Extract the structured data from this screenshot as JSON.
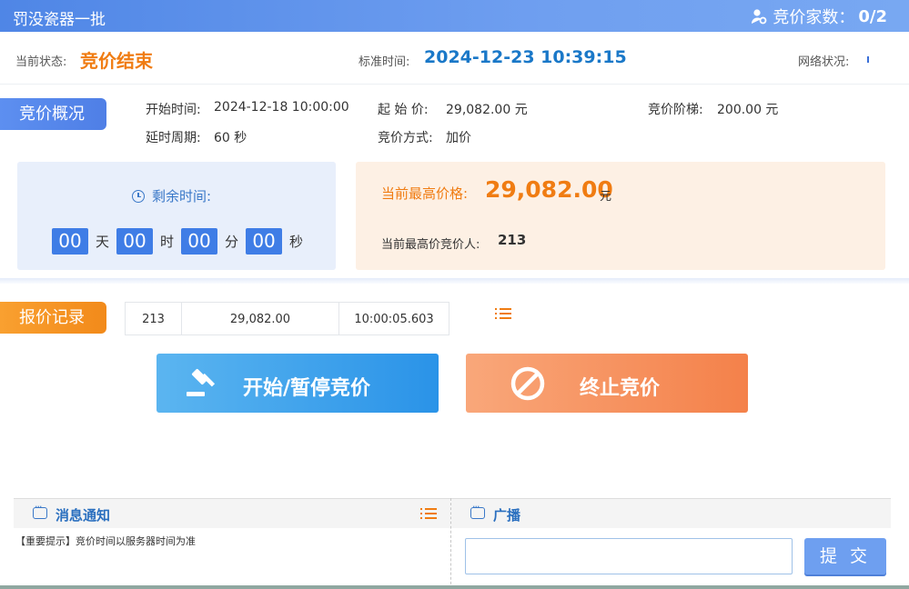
{
  "titlebar": {
    "title": "罚没瓷器一批",
    "bidders_label": "竞价家数：",
    "bidders_value": "0/2"
  },
  "status": {
    "state_label": "当前状态:",
    "state_value": "竞价结束",
    "time_label": "标准时间:",
    "time_value": "2024-12-23 10:39:15",
    "network_label": "网络状况:"
  },
  "overview": {
    "tag": "竞价概况",
    "start_time_label": "开始时间:",
    "start_time_value": "2024-12-18 10:00:00",
    "start_price_label": "起 始 价:",
    "start_price_value": "29,082.00 元",
    "step_label": "竞价阶梯:",
    "step_value": "200.00 元",
    "delay_label": "延时周期:",
    "delay_value": "60 秒",
    "mode_label": "竞价方式:",
    "mode_value": "加价"
  },
  "countdown": {
    "label": "剩余时间:",
    "days": "00",
    "days_unit": "天",
    "hours": "00",
    "hours_unit": "时",
    "minutes": "00",
    "minutes_unit": "分",
    "seconds": "00",
    "seconds_unit": "秒"
  },
  "highest": {
    "price_label": "当前最高价格:",
    "price_value": "29,082.00",
    "price_unit": "元",
    "bidder_label": "当前最高价竞价人:",
    "bidder_value": "213"
  },
  "records": {
    "tag": "报价记录",
    "rows": [
      {
        "bidder": "213",
        "price": "29,082.00",
        "time": "10:00:05.603"
      }
    ]
  },
  "actions": {
    "start_pause": "开始/暂停竞价",
    "stop": "终止竞价"
  },
  "messages": {
    "title": "消息通知",
    "notice": "【重要提示】竞价时间以服务器时间为准"
  },
  "broadcast": {
    "title": "广播",
    "input_value": "",
    "submit": "提 交"
  },
  "colors": {
    "accent_blue": "#4f86e6",
    "accent_orange": "#f07c12"
  }
}
